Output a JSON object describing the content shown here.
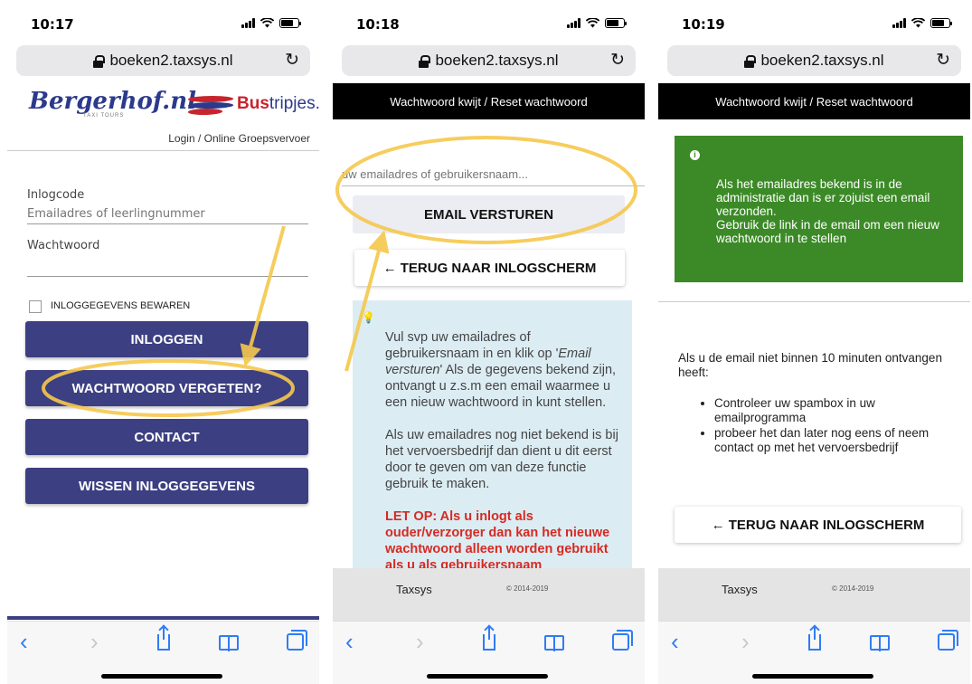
{
  "colors": {
    "navy": "#3c3f82",
    "green": "#3c8a27",
    "warn": "#d62a22",
    "info_bg": "#dcecf3",
    "highlight": "#f5c84c",
    "ios_blue": "#2f7cf6"
  },
  "phones": [
    {
      "time": "10:17",
      "url": "boeken2.taxsys.nl"
    },
    {
      "time": "10:18",
      "url": "boeken2.taxsys.nl"
    },
    {
      "time": "10:19",
      "url": "boeken2.taxsys.nl"
    }
  ],
  "login": {
    "logo_left": "Bergerhof.nl",
    "logo_tagline": "TAXI TOURS",
    "logo_right_a": "Bus",
    "logo_right_b": "tripjes.",
    "subnav": "Login / Online Groepsvervoer",
    "code_label": "Inlogcode",
    "code_placeholder": "Emailadres of leerlingnummer",
    "password_label": "Wachtwoord",
    "remember_label": "INLOGGEGEVENS BEWAREN",
    "login_button": "INLOGGEN",
    "forgot_button": "WACHTWOORD VERGETEN?",
    "contact_button": "CONTACT",
    "clear_button": "WISSEN INLOGGEGEVENS"
  },
  "reset": {
    "header": "Wachtwoord kwijt / Reset wachtwoord",
    "email_placeholder": "uw emailadres of gebruikersnaam...",
    "send_button": "EMAIL VERSTUREN",
    "back_button": "← TERUG NAAR INLOGSCHERM",
    "info_p1_a": "Vul svp uw emailadres of gebruikersnaam in en klik op '",
    "info_p1_em": "Email versturen",
    "info_p1_b": "' Als de gegevens bekend zijn, ontvangt u z.s.m een email waarmee u een nieuw wachtwoord in kunt stellen.",
    "info_p2": "Als uw emailadres nog niet bekend is bij het vervoersbedrijf dan dient u dit eerst door te geven om van deze functie gebruik te maken.",
    "info_warn": "LET OP: Als u inlogt als ouder/verzorger dan kan het nieuwe wachtwoord alleen worden gebruikt als u als gebruikersnaam"
  },
  "confirm": {
    "header": "Wachtwoord kwijt / Reset wachtwoord",
    "green_msg_1": "Als het emailadres bekend is in de administratie dan is er zojuist een email verzonden.",
    "green_msg_2": "Gebruik de link in de email om een nieuw wachtwoord in te stellen",
    "intro": "Als u de email niet binnen 10 minuten ontvangen heeft:",
    "tips": [
      "Controleer uw spambox in uw emailprogramma",
      "probeer het dan later nog eens of neem contact op met het vervoersbedrijf"
    ],
    "back_button": "← TERUG NAAR INLOGSCHERM"
  },
  "footer": {
    "brand": "Taxsys",
    "copyright": "© 2014-2019"
  },
  "toolbar": {
    "back": "‹",
    "forward": "›"
  }
}
